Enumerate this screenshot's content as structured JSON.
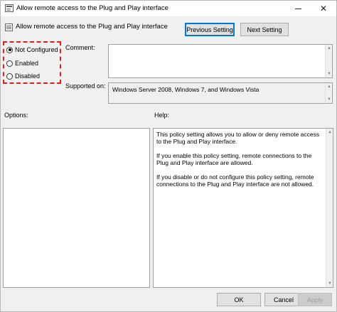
{
  "window": {
    "title": "Allow remote access to the Plug and Play interface"
  },
  "header": {
    "policy_title": "Allow remote access to the Plug and Play interface",
    "previous_label": "Previous Setting",
    "next_label": "Next Setting"
  },
  "state": {
    "options": [
      "Not Configured",
      "Enabled",
      "Disabled"
    ],
    "selected": "Not Configured"
  },
  "labels": {
    "comment": "Comment:",
    "supported_on": "Supported on:",
    "options": "Options:",
    "help": "Help:"
  },
  "supported_on_value": "Windows Server 2008, Windows 7, and Windows Vista",
  "help": {
    "paragraphs": [
      "This policy setting allows you to allow or deny remote access to the Plug and Play interface.",
      "If you enable this policy setting, remote connections to the Plug and Play interface are allowed.",
      "If you disable or do not configure this policy setting, remote connections to the Plug and Play interface are not allowed."
    ]
  },
  "footer": {
    "ok_label": "OK",
    "cancel_label": "Cancel",
    "apply_label": "Apply"
  },
  "colors": {
    "highlight_border": "#e02020",
    "focus_border": "#0078d7"
  }
}
